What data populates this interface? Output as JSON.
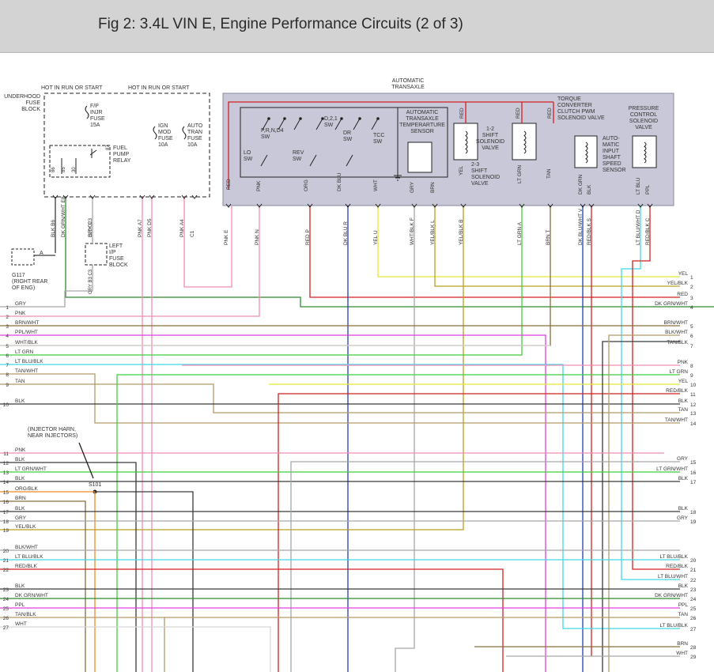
{
  "title": "Fig 2: 3.4L VIN E, Engine Performance Circuits (2 of 3)",
  "underhood": {
    "hot_run_start_1": "HOT IN RUN OR START",
    "hot_run_start_2": "HOT IN RUN OR START",
    "fuse_block_label": [
      "UNDERHOOD",
      "FUSE",
      "BLOCK"
    ],
    "fp_fuse": [
      "F/P",
      "INJR",
      "FUSE",
      "15A"
    ],
    "ign_fuse": [
      "IGN",
      "MOD",
      "FUSE",
      "10A"
    ],
    "tran_fuse": [
      "AUTO",
      "TRAN",
      "FUSE",
      "10A"
    ],
    "relay": [
      "FUEL",
      "PUMP",
      "RELAY"
    ],
    "relay_pins": [
      "86",
      "85",
      "30",
      "87"
    ]
  },
  "left_ip": [
    "LEFT",
    "I/P",
    "FUSE",
    "BLOCK"
  ],
  "ground": [
    "G117",
    "(RIGHT REAR",
    "OF ENG)"
  ],
  "ground_pin": "A",
  "transaxle": {
    "header": [
      "AUTOMATIC",
      "TRANSAXLE"
    ],
    "switches": {
      "prnd4": [
        "P,R,N,D4",
        "SW"
      ],
      "d21": [
        "D,2,1",
        "SW"
      ],
      "lo": [
        "LO",
        "SW"
      ],
      "rev": [
        "REV",
        "SW"
      ],
      "dr": [
        "DR",
        "SW"
      ],
      "tcc": [
        "TCC",
        "SW"
      ]
    },
    "temp_sensor": [
      "AUTOMATIC",
      "TRANSAXLE",
      "TEMPERARTURE",
      "SENSOR"
    ],
    "shift_12": [
      "1-2",
      "SHIFT",
      "SOLENOID",
      "VALVE"
    ],
    "shift_23": [
      "2-3",
      "SHIFT",
      "SOLENOID",
      "VALVE"
    ],
    "tcc_pwm": [
      "TORQUE",
      "CONVERTER",
      "CLUTCH PWM",
      "SOLENOID VALVE"
    ],
    "input_speed": [
      "AUTO-",
      "MATIC",
      "INPUT",
      "SHAFT",
      "SPEED",
      "SENSOR"
    ],
    "pressure": [
      "PRESSURE",
      "CONTROL",
      "SOLENOID",
      "VALVE"
    ],
    "top_wires": [
      "RED",
      "RED",
      "RED"
    ],
    "inner_wires": [
      "RED",
      "PNK",
      "ORG",
      "DK BLU",
      "WHT",
      "GRY",
      "BRN",
      "YEL",
      "LT GRN",
      "TAN",
      "DK GRN",
      "BLK",
      "LT BLU",
      "PPL"
    ]
  },
  "connectors_top": [
    {
      "wire": "BLK",
      "pin": "B6"
    },
    {
      "wire": "DK GRN/WHT",
      "pin": "E8"
    },
    {
      "wire": "GRY",
      "pin": "C3"
    },
    {
      "wire": "PNK",
      "pin": "A7"
    },
    {
      "wire": "PNK",
      "pin": "D5"
    },
    {
      "wire": "PNK",
      "pin": "A4"
    },
    {
      "wire": "",
      "pin": "C1"
    }
  ],
  "ip_pins": {
    "upper": [
      "B10",
      "C2"
    ],
    "lower": [
      "B3",
      "C3"
    ],
    "wire": "GRY"
  },
  "connectors_trans": [
    {
      "wire": "PNK",
      "pin": "E"
    },
    {
      "wire": "PNK",
      "pin": "N"
    },
    {
      "wire": "RED",
      "pin": "P"
    },
    {
      "wire": "DK BLU",
      "pin": "R"
    },
    {
      "wire": "YEL",
      "pin": "U"
    },
    {
      "wire": "WHT/BLK",
      "pin": "F"
    },
    {
      "wire": "YEL/BLK",
      "pin": "L"
    },
    {
      "wire": "YEL/BLK",
      "pin": "B"
    },
    {
      "wire": "LT GRN",
      "pin": "A"
    },
    {
      "wire": "BRN",
      "pin": "T"
    },
    {
      "wire": "DK BLU/WHT",
      "pin": "V"
    },
    {
      "wire": "RED/BLK",
      "pin": "S"
    },
    {
      "wire": "LT BLU/WHT",
      "pin": "D"
    },
    {
      "wire": "RED/BLK",
      "pin": "C"
    }
  ],
  "left_labels": [
    {
      "n": "1",
      "t": "GRY"
    },
    {
      "n": "2",
      "t": "PNK"
    },
    {
      "n": "3",
      "t": "BRN/WHT"
    },
    {
      "n": "4",
      "t": "PPL/WHT"
    },
    {
      "n": "5",
      "t": "WHT/BLK"
    },
    {
      "n": "6",
      "t": "LT GRN"
    },
    {
      "n": "7",
      "t": "LT BLU/BLK"
    },
    {
      "n": "8",
      "t": "TAN/WHT"
    },
    {
      "n": "9",
      "t": "TAN"
    },
    {
      "n": "10",
      "t": "BLK"
    },
    {
      "n": "11",
      "t": "PNK"
    },
    {
      "n": "12",
      "t": "BLK"
    },
    {
      "n": "13",
      "t": "LT GRN/WHT"
    },
    {
      "n": "14",
      "t": "BLK"
    },
    {
      "n": "15",
      "t": "ORG/BLK"
    },
    {
      "n": "16",
      "t": "BRN"
    },
    {
      "n": "17",
      "t": "BLK"
    },
    {
      "n": "18",
      "t": "GRY"
    },
    {
      "n": "19",
      "t": "YEL/BLK"
    },
    {
      "n": "20",
      "t": "BLK/WHT"
    },
    {
      "n": "21",
      "t": "LT BLU/BLK"
    },
    {
      "n": "22",
      "t": "RED/BLK"
    },
    {
      "n": "23",
      "t": "BLK"
    },
    {
      "n": "24",
      "t": "DK GRN/WHT"
    },
    {
      "n": "25",
      "t": "PPL"
    },
    {
      "n": "26",
      "t": "TAN/BLK"
    },
    {
      "n": "27",
      "t": "WHT"
    }
  ],
  "right_labels": [
    {
      "n": "1",
      "t": "YEL"
    },
    {
      "n": "2",
      "t": "YEL/BLK"
    },
    {
      "n": "3",
      "t": "RED"
    },
    {
      "n": "4",
      "t": "DK GRN/WHT"
    },
    {
      "n": "5",
      "t": "BRN/WHT"
    },
    {
      "n": "6",
      "t": "BLK/WHT"
    },
    {
      "n": "7",
      "t": "TAN/BLK"
    },
    {
      "n": "8",
      "t": "PNK"
    },
    {
      "n": "9",
      "t": "LT GRN"
    },
    {
      "n": "10",
      "t": "YEL"
    },
    {
      "n": "11",
      "t": "RED/BLK"
    },
    {
      "n": "12",
      "t": "BLK"
    },
    {
      "n": "13",
      "t": "TAN"
    },
    {
      "n": "14",
      "t": "TAN/WHT"
    },
    {
      "n": "15",
      "t": "GRY"
    },
    {
      "n": "16",
      "t": "LT GRN/WHT"
    },
    {
      "n": "17",
      "t": "BLK"
    },
    {
      "n": "18",
      "t": "BLK"
    },
    {
      "n": "19",
      "t": "GRY"
    },
    {
      "n": "20",
      "t": "LT BLU/BLK"
    },
    {
      "n": "21",
      "t": "RED/BLK"
    },
    {
      "n": "22",
      "t": "LT BLU/WHT"
    },
    {
      "n": "23",
      "t": "BLK"
    },
    {
      "n": "24",
      "t": "DK GRN/WHT"
    },
    {
      "n": "25",
      "t": "PPL"
    },
    {
      "n": "26",
      "t": "TAN"
    },
    {
      "n": "27",
      "t": "LT BLU/BLK"
    },
    {
      "n": "28",
      "t": "BRN"
    },
    {
      "n": "29",
      "t": "WHT"
    }
  ],
  "injector_note": [
    "(INJECTOR HARN,",
    "NEAR INJECTORS)"
  ],
  "splice": "S101",
  "colors": {
    "GRY": "#a6a6a6",
    "PNK": "#f08cb4",
    "BRN": "#8a6d3b",
    "PPL": "#e040e0",
    "WHT": "#d8d8d8",
    "LTGRN": "#3fcf3f",
    "LTBLU": "#40d8e8",
    "TAN": "#b59a6a",
    "BLK": "#3a3a3a",
    "YEL": "#e8e830",
    "RED": "#d42020",
    "DKGRN": "#2e8b2e",
    "ORG": "#f08a24",
    "DKBLU": "#1f3fb8",
    "box": "#c8c8d8"
  }
}
